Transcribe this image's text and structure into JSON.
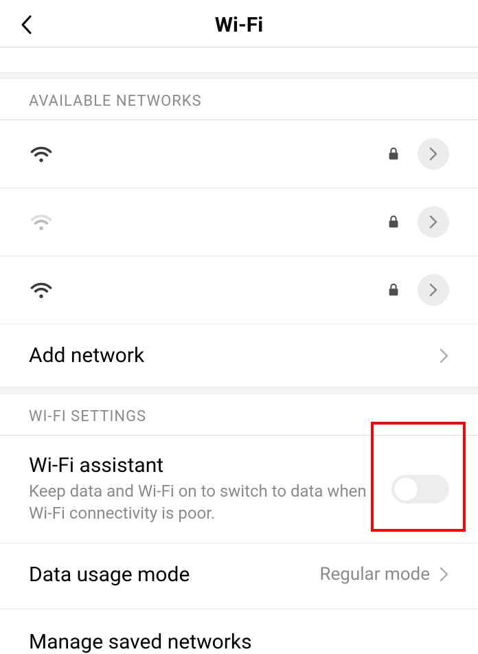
{
  "header": {
    "title": "Wi-Fi"
  },
  "sections": {
    "available_label": "AVAILABLE NETWORKS",
    "settings_label": "WI-FI SETTINGS"
  },
  "networks": [
    {
      "name": "",
      "signal": "strong",
      "locked": true
    },
    {
      "name": "",
      "signal": "weak",
      "locked": true
    },
    {
      "name": "",
      "signal": "strong",
      "locked": true
    }
  ],
  "add_network": {
    "label": "Add network"
  },
  "wifi_assistant": {
    "title": "Wi-Fi assistant",
    "desc": "Keep data and Wi-Fi on to switch to data when Wi-Fi connectivity is poor.",
    "enabled": false
  },
  "data_usage": {
    "title": "Data usage mode",
    "value": "Regular mode"
  },
  "manage": {
    "title": "Manage saved networks"
  }
}
